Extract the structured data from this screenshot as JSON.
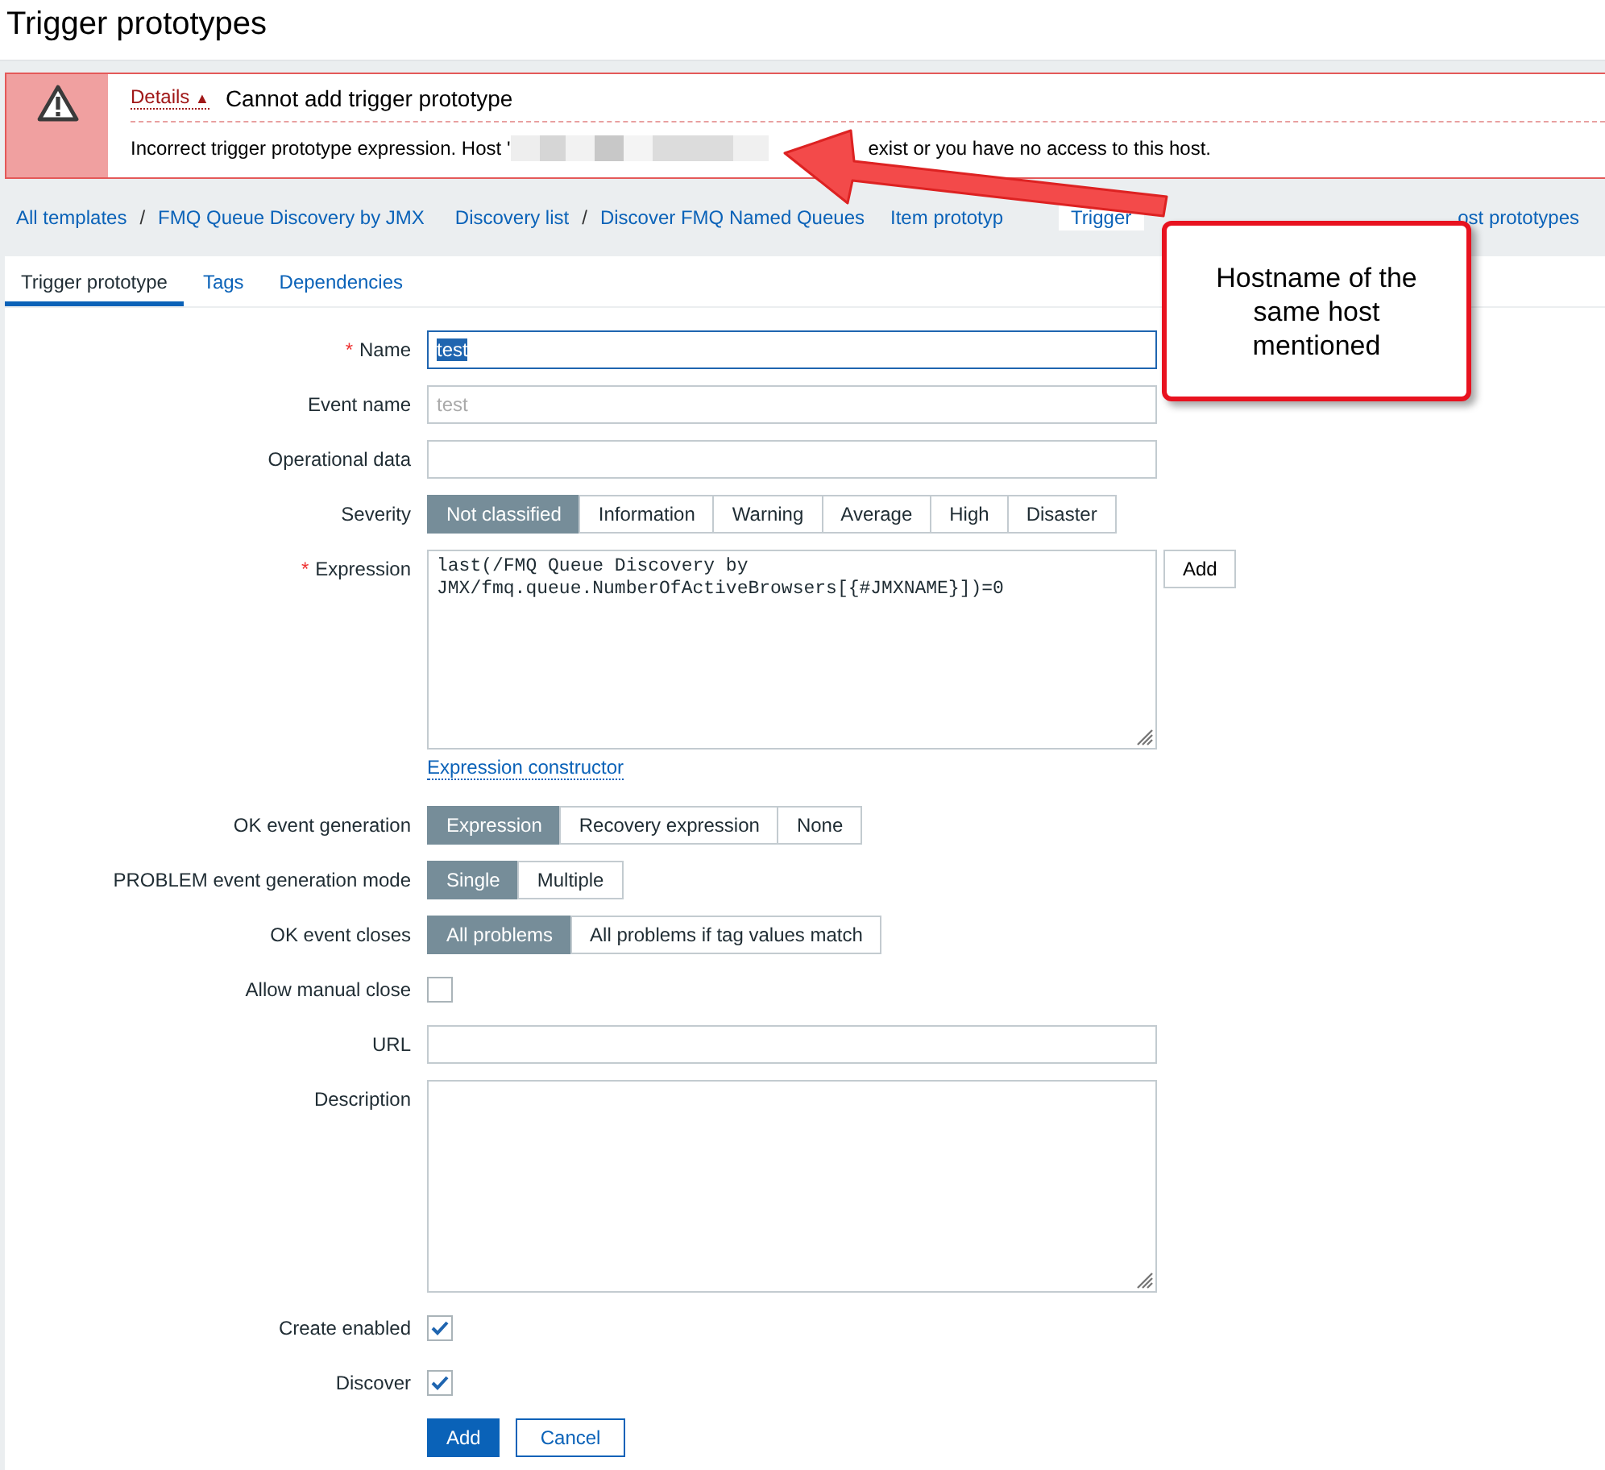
{
  "page_title": "Trigger prototypes",
  "error": {
    "toggle": "Details",
    "toggle_icon": "▲",
    "title": "Cannot add trigger prototype",
    "message_start": "Incorrect trigger prototype expression. Host '",
    "message_end": "exist or you have no access to this host."
  },
  "nav": [
    {
      "kind": "link",
      "label": "All templates"
    },
    {
      "kind": "separator",
      "label": "/"
    },
    {
      "kind": "link",
      "label": "FMQ Queue Discovery by JMX"
    },
    {
      "kind": "link",
      "label": "Discovery list"
    },
    {
      "kind": "separator",
      "label": "/"
    },
    {
      "kind": "link",
      "label": "Discover FMQ Named Queues"
    },
    {
      "kind": "tab",
      "label": "Item prototyp",
      "selected": false
    },
    {
      "kind": "tab",
      "label": "Trigger",
      "selected": true
    },
    {
      "kind": "tab",
      "label": "ost prototypes",
      "selected": false
    }
  ],
  "tabs": [
    {
      "label": "Trigger prototype",
      "selected": true
    },
    {
      "label": "Tags",
      "selected": false
    },
    {
      "label": "Dependencies",
      "selected": false
    }
  ],
  "fields": [
    {
      "kind": "text",
      "label": "Name",
      "required_mark": "*",
      "value": "test",
      "focused": true
    },
    {
      "kind": "text",
      "label": "Event name",
      "placeholder": "test",
      "focused": false
    },
    {
      "kind": "text",
      "label": "Operational data",
      "focused": false
    },
    {
      "kind": "segmented",
      "label": "Severity",
      "options": [
        {
          "label": "Not classified",
          "selected": true
        },
        {
          "label": "Information",
          "selected": false
        },
        {
          "label": "Warning",
          "selected": false
        },
        {
          "label": "Average",
          "selected": false
        },
        {
          "label": "High",
          "selected": false
        },
        {
          "label": "Disaster",
          "selected": false
        }
      ]
    },
    {
      "kind": "textarea",
      "label": "Expression",
      "required_mark": "*",
      "value": "last(/FMQ Queue Discovery by JMX/fmq.queue.NumberOfActiveBrowsers[{#JMXNAME}])=0",
      "side_button": "Add",
      "link": "Expression constructor"
    },
    {
      "kind": "segmented",
      "label": "OK event generation",
      "options": [
        {
          "label": "Expression",
          "selected": true
        },
        {
          "label": "Recovery expression",
          "selected": false
        },
        {
          "label": "None",
          "selected": false
        }
      ]
    },
    {
      "kind": "segmented",
      "label": "PROBLEM event generation mode",
      "options": [
        {
          "label": "Single",
          "selected": true
        },
        {
          "label": "Multiple",
          "selected": false
        }
      ]
    },
    {
      "kind": "segmented",
      "label": "OK event closes",
      "options": [
        {
          "label": "All problems",
          "selected": true
        },
        {
          "label": "All problems if tag values match",
          "selected": false
        }
      ]
    },
    {
      "kind": "checkbox",
      "label": "Allow manual close",
      "checked": false
    },
    {
      "kind": "text",
      "label": "URL",
      "focused": false
    },
    {
      "kind": "textarea",
      "label": "Description"
    },
    {
      "kind": "checkbox",
      "label": "Create enabled",
      "checked": true
    },
    {
      "kind": "checkbox",
      "label": "Discover",
      "checked": true
    }
  ],
  "buttons": [
    {
      "label": "Add",
      "primary": true
    },
    {
      "label": "Cancel",
      "primary": false
    }
  ],
  "callout": "Hostname of the same host mentioned"
}
